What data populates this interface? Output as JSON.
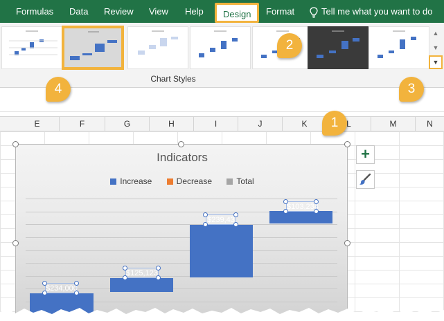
{
  "ribbon": {
    "tabs": [
      {
        "label": "Formulas"
      },
      {
        "label": "Data"
      },
      {
        "label": "Review"
      },
      {
        "label": "View"
      },
      {
        "label": "Help"
      },
      {
        "label": "Design"
      },
      {
        "label": "Format"
      }
    ],
    "tell_me": "Tell me what you want to do",
    "group_label": "Chart Styles",
    "more_icon": "more-dropdown-icon"
  },
  "columns": [
    "E",
    "F",
    "G",
    "H",
    "I",
    "J",
    "K",
    "L",
    "M",
    "N"
  ],
  "chart": {
    "title": "Indicators",
    "legend": [
      {
        "label": "Increase",
        "color": "#4472c4"
      },
      {
        "label": "Decrease",
        "color": "#ed7d31"
      },
      {
        "label": "Total",
        "color": "#a5a5a5"
      }
    ],
    "data_labels": [
      "$234,000",
      "$125,123",
      "$239,43",
      "$103,234"
    ]
  },
  "callouts": [
    "1",
    "2",
    "3",
    "4"
  ],
  "colors": {
    "excel_green": "#217346",
    "highlight": "#f2b33d",
    "bar_blue": "#4472c4"
  }
}
